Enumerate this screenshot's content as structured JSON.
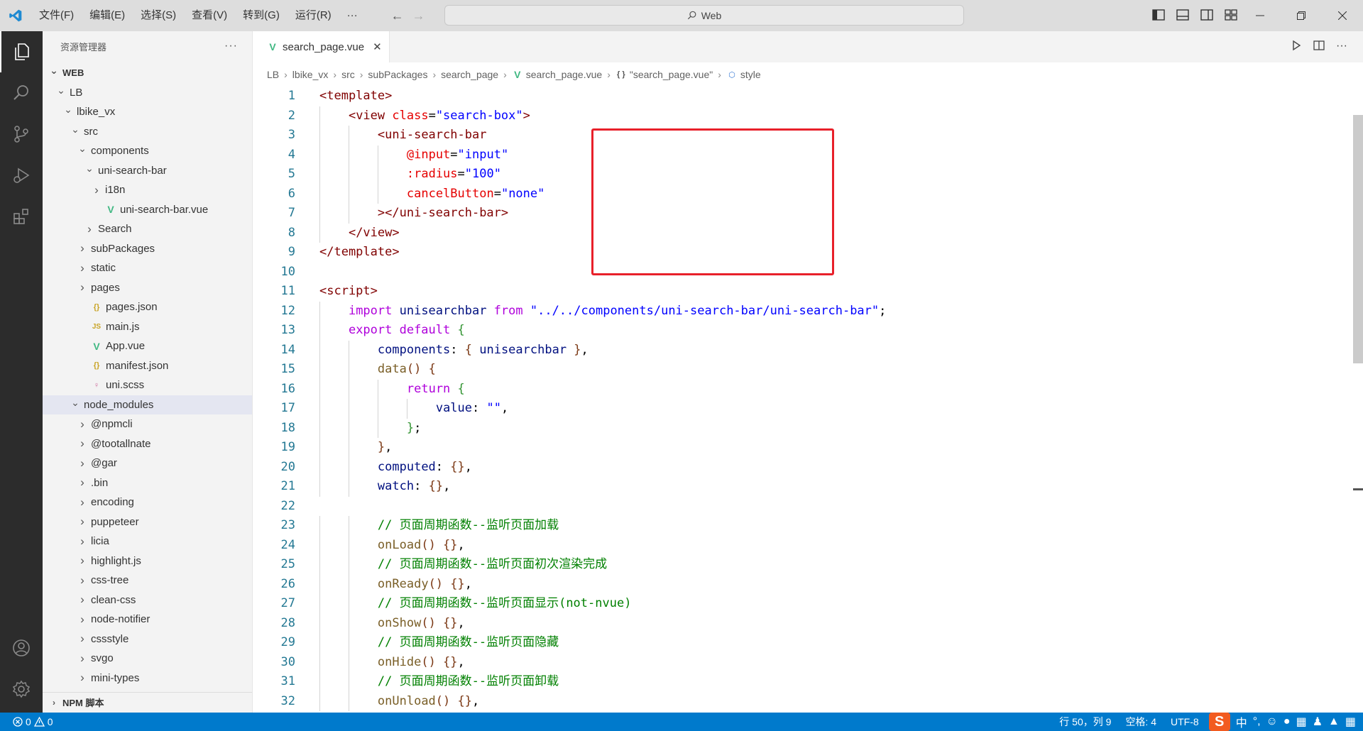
{
  "titlebar": {
    "menus": [
      "文件(F)",
      "编辑(E)",
      "选择(S)",
      "查看(V)",
      "转到(G)",
      "运行(R)",
      "···"
    ],
    "search_text": "Web"
  },
  "explorer": {
    "title": "资源管理器",
    "more": "···",
    "tree": [
      {
        "label": "WEB",
        "depth": 0,
        "chevron": "down",
        "icon": "",
        "section": true
      },
      {
        "label": "LB",
        "depth": 1,
        "chevron": "down",
        "icon": ""
      },
      {
        "label": "lbike_vx",
        "depth": 2,
        "chevron": "down",
        "icon": ""
      },
      {
        "label": "src",
        "depth": 3,
        "chevron": "down",
        "icon": ""
      },
      {
        "label": "components",
        "depth": 4,
        "chevron": "down",
        "icon": ""
      },
      {
        "label": "uni-search-bar",
        "depth": 5,
        "chevron": "down",
        "icon": ""
      },
      {
        "label": "i18n",
        "depth": 6,
        "chevron": "right",
        "icon": ""
      },
      {
        "label": "uni-search-bar.vue",
        "depth": 6,
        "chevron": "",
        "icon": "vue"
      },
      {
        "label": "Search",
        "depth": 5,
        "chevron": "right",
        "icon": ""
      },
      {
        "label": "subPackages",
        "depth": 4,
        "chevron": "right",
        "icon": ""
      },
      {
        "label": "static",
        "depth": 4,
        "chevron": "right",
        "icon": ""
      },
      {
        "label": "pages",
        "depth": 4,
        "chevron": "right",
        "icon": ""
      },
      {
        "label": "pages.json",
        "depth": 4,
        "chevron": "",
        "icon": "json"
      },
      {
        "label": "main.js",
        "depth": 4,
        "chevron": "",
        "icon": "js"
      },
      {
        "label": "App.vue",
        "depth": 4,
        "chevron": "",
        "icon": "vue"
      },
      {
        "label": "manifest.json",
        "depth": 4,
        "chevron": "",
        "icon": "json"
      },
      {
        "label": "uni.scss",
        "depth": 4,
        "chevron": "",
        "icon": "scss"
      },
      {
        "label": "node_modules",
        "depth": 3,
        "chevron": "down",
        "icon": "",
        "selected": true
      },
      {
        "label": "@npmcli",
        "depth": 4,
        "chevron": "right",
        "icon": ""
      },
      {
        "label": "@tootallnate",
        "depth": 4,
        "chevron": "right",
        "icon": ""
      },
      {
        "label": "@gar",
        "depth": 4,
        "chevron": "right",
        "icon": ""
      },
      {
        "label": ".bin",
        "depth": 4,
        "chevron": "right",
        "icon": ""
      },
      {
        "label": "encoding",
        "depth": 4,
        "chevron": "right",
        "icon": ""
      },
      {
        "label": "puppeteer",
        "depth": 4,
        "chevron": "right",
        "icon": ""
      },
      {
        "label": "licia",
        "depth": 4,
        "chevron": "right",
        "icon": ""
      },
      {
        "label": "highlight.js",
        "depth": 4,
        "chevron": "right",
        "icon": ""
      },
      {
        "label": "css-tree",
        "depth": 4,
        "chevron": "right",
        "icon": ""
      },
      {
        "label": "clean-css",
        "depth": 4,
        "chevron": "right",
        "icon": ""
      },
      {
        "label": "node-notifier",
        "depth": 4,
        "chevron": "right",
        "icon": ""
      },
      {
        "label": "cssstyle",
        "depth": 4,
        "chevron": "right",
        "icon": ""
      },
      {
        "label": "svgo",
        "depth": 4,
        "chevron": "right",
        "icon": ""
      },
      {
        "label": "mini-types",
        "depth": 4,
        "chevron": "right",
        "icon": ""
      }
    ],
    "npm_section": "NPM 脚本"
  },
  "editor": {
    "tab_label": "search_page.vue",
    "breadcrumb": [
      "LB",
      "lbike_vx",
      "src",
      "subPackages",
      "search_page",
      "search_page.vue",
      "\"search_page.vue\"",
      "style"
    ],
    "breadcrumb_icons": [
      "",
      "",
      "",
      "",
      "",
      "vue",
      "braces",
      "style"
    ],
    "lines": [
      {
        "n": "1",
        "indent": 0,
        "tokens": [
          [
            "tg",
            "<template>"
          ]
        ]
      },
      {
        "n": "2",
        "indent": 1,
        "tokens": [
          [
            "tg",
            "<view "
          ],
          [
            "at",
            "class"
          ],
          [
            "pu",
            "="
          ],
          [
            "st",
            "\"search-box\""
          ],
          [
            "tg",
            ">"
          ]
        ]
      },
      {
        "n": "3",
        "indent": 2,
        "tokens": [
          [
            "tg",
            "<uni-search-bar"
          ]
        ]
      },
      {
        "n": "4",
        "indent": 3,
        "tokens": [
          [
            "at",
            "@input"
          ],
          [
            "pu",
            "="
          ],
          [
            "st",
            "\"input\""
          ]
        ]
      },
      {
        "n": "5",
        "indent": 3,
        "tokens": [
          [
            "at",
            ":radius"
          ],
          [
            "pu",
            "="
          ],
          [
            "st",
            "\"100\""
          ]
        ]
      },
      {
        "n": "6",
        "indent": 3,
        "tokens": [
          [
            "at",
            "cancelButton"
          ],
          [
            "pu",
            "="
          ],
          [
            "st",
            "\"none\""
          ]
        ]
      },
      {
        "n": "7",
        "indent": 2,
        "tokens": [
          [
            "tg",
            "></uni-search-bar>"
          ]
        ]
      },
      {
        "n": "8",
        "indent": 1,
        "tokens": [
          [
            "tg",
            "</view>"
          ]
        ]
      },
      {
        "n": "9",
        "indent": 0,
        "tokens": [
          [
            "tg",
            "</template>"
          ]
        ]
      },
      {
        "n": "10",
        "indent": 0,
        "tokens": []
      },
      {
        "n": "11",
        "indent": 0,
        "tokens": [
          [
            "tg",
            "<script>"
          ]
        ]
      },
      {
        "n": "12",
        "indent": 1,
        "tokens": [
          [
            "kw",
            "import "
          ],
          [
            "id",
            "unisearchbar "
          ],
          [
            "kw",
            "from "
          ],
          [
            "st",
            "\"../../components/uni-search-bar/uni-search-bar\""
          ],
          [
            "pu",
            ";"
          ]
        ]
      },
      {
        "n": "13",
        "indent": 1,
        "tokens": [
          [
            "kw",
            "export default "
          ],
          [
            "br",
            "{"
          ]
        ]
      },
      {
        "n": "14",
        "indent": 2,
        "tokens": [
          [
            "id",
            "components"
          ],
          [
            "pu",
            ": "
          ],
          [
            "br2",
            "{ "
          ],
          [
            "id",
            "unisearchbar "
          ],
          [
            "br2",
            "}"
          ],
          [
            "pu",
            ","
          ]
        ]
      },
      {
        "n": "15",
        "indent": 2,
        "tokens": [
          [
            "fn",
            "data"
          ],
          [
            "br2",
            "() "
          ],
          [
            "br2",
            "{"
          ]
        ]
      },
      {
        "n": "16",
        "indent": 3,
        "tokens": [
          [
            "kw",
            "return "
          ],
          [
            "br",
            "{"
          ]
        ]
      },
      {
        "n": "17",
        "indent": 4,
        "tokens": [
          [
            "id",
            "value"
          ],
          [
            "pu",
            ": "
          ],
          [
            "st",
            "\"\""
          ],
          [
            "pu",
            ","
          ]
        ]
      },
      {
        "n": "18",
        "indent": 3,
        "tokens": [
          [
            "br",
            "}"
          ],
          [
            "pu",
            ";"
          ]
        ]
      },
      {
        "n": "19",
        "indent": 2,
        "tokens": [
          [
            "br2",
            "}"
          ],
          [
            "pu",
            ","
          ]
        ]
      },
      {
        "n": "20",
        "indent": 2,
        "tokens": [
          [
            "id",
            "computed"
          ],
          [
            "pu",
            ": "
          ],
          [
            "br2",
            "{}"
          ],
          [
            "pu",
            ","
          ]
        ]
      },
      {
        "n": "21",
        "indent": 2,
        "tokens": [
          [
            "id",
            "watch"
          ],
          [
            "pu",
            ": "
          ],
          [
            "br2",
            "{}"
          ],
          [
            "pu",
            ","
          ]
        ]
      },
      {
        "n": "22",
        "indent": 0,
        "tokens": []
      },
      {
        "n": "23",
        "indent": 2,
        "tokens": [
          [
            "cm",
            "// 页面周期函数--监听页面加载"
          ]
        ]
      },
      {
        "n": "24",
        "indent": 2,
        "tokens": [
          [
            "fn",
            "onLoad"
          ],
          [
            "br2",
            "() {}"
          ],
          [
            "pu",
            ","
          ]
        ]
      },
      {
        "n": "25",
        "indent": 2,
        "tokens": [
          [
            "cm",
            "// 页面周期函数--监听页面初次渲染完成"
          ]
        ]
      },
      {
        "n": "26",
        "indent": 2,
        "tokens": [
          [
            "fn",
            "onReady"
          ],
          [
            "br2",
            "() {}"
          ],
          [
            "pu",
            ","
          ]
        ]
      },
      {
        "n": "27",
        "indent": 2,
        "tokens": [
          [
            "cm",
            "// 页面周期函数--监听页面显示(not-nvue)"
          ]
        ]
      },
      {
        "n": "28",
        "indent": 2,
        "tokens": [
          [
            "fn",
            "onShow"
          ],
          [
            "br2",
            "() {}"
          ],
          [
            "pu",
            ","
          ]
        ]
      },
      {
        "n": "29",
        "indent": 2,
        "tokens": [
          [
            "cm",
            "// 页面周期函数--监听页面隐藏"
          ]
        ]
      },
      {
        "n": "30",
        "indent": 2,
        "tokens": [
          [
            "fn",
            "onHide"
          ],
          [
            "br2",
            "() {}"
          ],
          [
            "pu",
            ","
          ]
        ]
      },
      {
        "n": "31",
        "indent": 2,
        "tokens": [
          [
            "cm",
            "// 页面周期函数--监听页面卸载"
          ]
        ]
      },
      {
        "n": "32",
        "indent": 2,
        "tokens": [
          [
            "fn",
            "onUnload"
          ],
          [
            "br2",
            "() {}"
          ],
          [
            "pu",
            ","
          ]
        ]
      }
    ]
  },
  "statusbar": {
    "errors": "0",
    "warnings": "0",
    "position": "行 50，列 9",
    "spaces": "空格: 4",
    "encoding": "UTF-8",
    "ime_logo": "S",
    "ime_mode": "中"
  },
  "colors": {
    "accent": "#007acc",
    "highlight_box": "#e8202a",
    "activity_bar": "#2c2c2c"
  }
}
